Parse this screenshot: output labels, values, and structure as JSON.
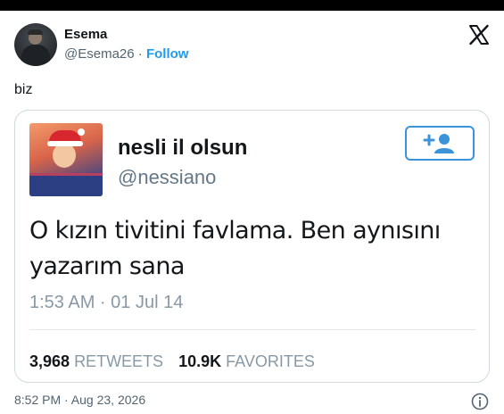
{
  "author": {
    "name": "Esema",
    "handle": "@Esema26",
    "separator": "·",
    "follow_label": "Follow"
  },
  "tweet": {
    "text": "biz"
  },
  "embedded_tweet": {
    "name": "nesli il olsun",
    "handle": "@nessiano",
    "text": "O kızın tivitini favlama. Ben aynısını yazarım sana",
    "time": "1:53 AM · 01 Jul 14",
    "retweets_count": "3,968",
    "retweets_label": "RETWEETS",
    "favorites_count": "10.9K",
    "favorites_label": "FAVORITES"
  },
  "footer": {
    "timestamp": "8:52 PM · Aug 23, 2026"
  },
  "icons": {
    "platform": "x-logo-icon",
    "follow": "add-user-icon",
    "info": "info-icon"
  },
  "colors": {
    "accent": "#1d9bf0",
    "follow_button_border": "#3b94d9",
    "secondary_text": "#536471",
    "legacy_gray": "#8899a6",
    "border": "#cfd9de"
  }
}
